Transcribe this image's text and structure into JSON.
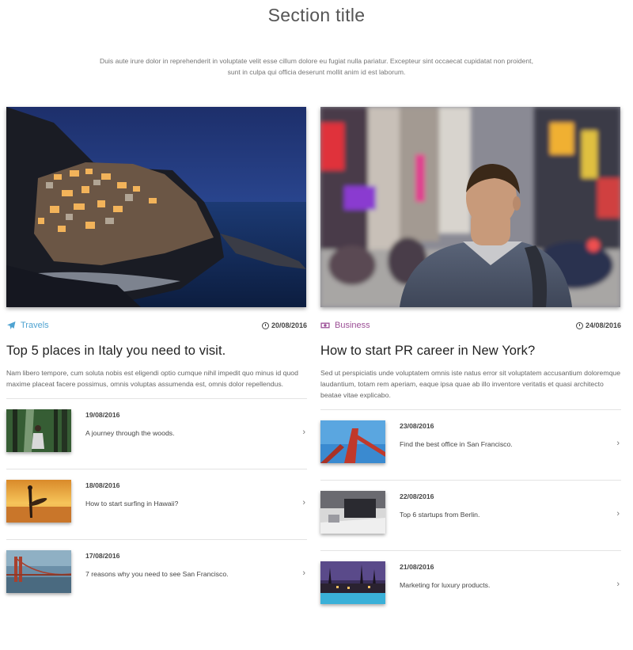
{
  "section": {
    "title": "Section title",
    "intro": "Duis aute irure dolor in reprehenderit in voluptate velit esse cillum dolore eu fugiat nulla pariatur. Excepteur sint occaecat cupidatat non proident, sunt in culpa qui officia deserunt mollit anim id est laborum."
  },
  "columns": [
    {
      "category": "Travels",
      "category_icon": "airplane-icon",
      "category_color": "#4fa3d1",
      "date": "20/08/2016",
      "title": "Top 5 places in Italy you need to visit.",
      "excerpt": "Nam libero tempore, cum soluta nobis est eligendi optio cumque nihil impedit quo minus id quod maxime placeat facere possimus, omnis voluptas assumenda est, omnis dolor repellendus.",
      "items": [
        {
          "date": "19/08/2016",
          "text": "A journey through the woods."
        },
        {
          "date": "18/08/2016",
          "text": "How to start surfing in Hawaii?"
        },
        {
          "date": "17/08/2016",
          "text": "7 reasons why you need to see San Francisco."
        }
      ]
    },
    {
      "category": "Business",
      "category_icon": "money-icon",
      "category_color": "#9c4f96",
      "date": "24/08/2016",
      "title": "How to start PR career in New York?",
      "excerpt": "Sed ut perspiciatis unde voluptatem omnis iste natus error sit voluptatem accusantium doloremque laudantium, totam rem aperiam, eaque ipsa quae ab illo inventore veritatis et quasi architecto beatae vitae explicabo.",
      "items": [
        {
          "date": "23/08/2016",
          "text": "Find the best office in San Francisco."
        },
        {
          "date": "22/08/2016",
          "text": "Top 6 startups from Berlin."
        },
        {
          "date": "21/08/2016",
          "text": "Marketing for luxury products."
        }
      ]
    }
  ],
  "chevron_icon": "chevron-right-icon"
}
